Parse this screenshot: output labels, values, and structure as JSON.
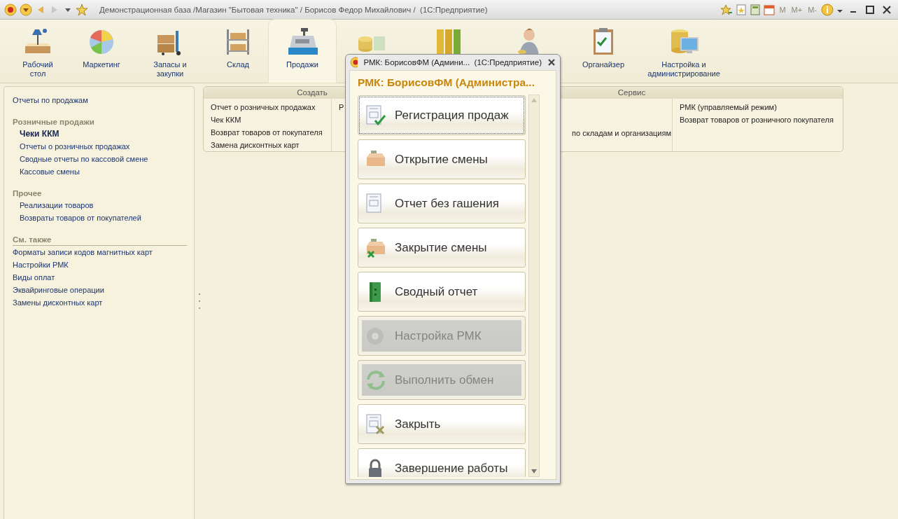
{
  "window": {
    "title": "Демонстрационная база /Магазин \"Бытовая техника\" / Борисов Федор Михайлович /  (1С:Предприятие)",
    "memory_buttons": [
      {
        "label": "M",
        "disabled": true
      },
      {
        "label": "M+",
        "disabled": true
      },
      {
        "label": "M-",
        "disabled": true
      }
    ]
  },
  "sections": [
    {
      "label": "Рабочий\nстол",
      "selected": false
    },
    {
      "label": "Маркетинг",
      "selected": false
    },
    {
      "label": "Запасы и\nзакупки",
      "selected": false
    },
    {
      "label": "Склад",
      "selected": false
    },
    {
      "label": "Продажи",
      "selected": true
    },
    {
      "selected": false
    },
    {
      "selected": false
    },
    {
      "selected": false
    },
    {
      "label": "Органайзер",
      "selected": false
    },
    {
      "label": "Настройка и\nадминистрирование",
      "selected": false
    }
  ],
  "navigation": [
    {
      "kind": "link",
      "label": "Отчеты по продажам"
    },
    {
      "kind": "group",
      "label": "Розничные продажи",
      "children": [
        {
          "label": "Чеки ККМ",
          "selected": true
        },
        {
          "label": "Отчеты о розничных продажах",
          "selected": false
        },
        {
          "label": "Сводные отчеты по кассовой смене",
          "selected": false
        },
        {
          "label": "Кассовые смены",
          "selected": false
        }
      ]
    },
    {
      "kind": "group",
      "label": "Прочее",
      "children": [
        {
          "label": "Реализации товаров",
          "selected": false
        },
        {
          "label": "Возвраты товаров от покупателей",
          "selected": false
        }
      ]
    },
    {
      "kind": "see_also",
      "label": "См. также",
      "children": [
        {
          "label": "Форматы записи кодов магнитных карт",
          "selected": false
        },
        {
          "label": "Настройки РМК",
          "selected": false
        },
        {
          "label": "Виды оплат",
          "selected": false
        },
        {
          "label": "Эквайринговые операции",
          "selected": false
        },
        {
          "label": "Замены дисконтных карт",
          "selected": false
        }
      ]
    }
  ],
  "actions": [
    {
      "title": "Создать",
      "columns": [
        [
          "Отчет о розничных продажах",
          "Чек ККМ",
          "Возврат товаров от покупателя",
          "Замена дисконтных карт"
        ],
        [
          "Р"
        ]
      ]
    },
    {
      "title": "Сервис",
      "columns": [
        [
          "по складам и организациям"
        ],
        [
          "РМК (управляемый режим)",
          "Возврат товаров от розничного покупателя"
        ]
      ]
    }
  ],
  "dialog": {
    "title": "РМК: БорисовФМ (Админи...  (1С:Предприятие)",
    "heading": "РМК: БорисовФМ (Администра...",
    "buttons": [
      {
        "label": "Регистрация продаж",
        "focused": true,
        "disabled": false
      },
      {
        "label": "Открытие смены",
        "focused": false,
        "disabled": false
      },
      {
        "label": "Отчет без гашения",
        "focused": false,
        "disabled": false
      },
      {
        "label": "Закрытие смены",
        "focused": false,
        "disabled": false
      },
      {
        "label": "Сводный отчет",
        "focused": false,
        "disabled": false
      },
      {
        "label": "Настройка РМК",
        "focused": false,
        "disabled": true
      },
      {
        "label": "Выполнить обмен",
        "focused": false,
        "disabled": true
      },
      {
        "label": "Закрыть",
        "focused": false,
        "disabled": false
      },
      {
        "label": "Завершение работы",
        "focused": false,
        "disabled": false
      }
    ]
  }
}
